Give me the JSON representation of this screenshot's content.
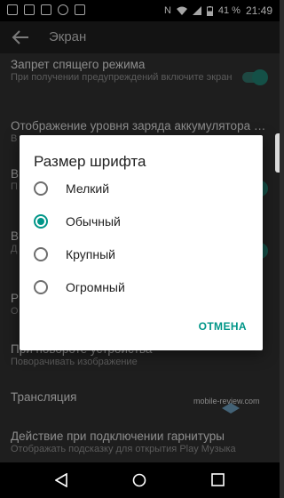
{
  "status_bar": {
    "battery": "41 %",
    "time": "21:49"
  },
  "app_bar": {
    "title": "Экран"
  },
  "settings": [
    {
      "title": "Запрет спящего режима",
      "subtitle": "При получении предупреждений включите экран",
      "toggle": true
    },
    {
      "title": "Отображение уровня заряда аккумулятора возле...",
      "subtitle": "В",
      "toggle": false
    },
    {
      "title": "В",
      "subtitle": "П",
      "toggle": true
    },
    {
      "title": "В",
      "subtitle": "Д",
      "toggle": true
    },
    {
      "title": "Р",
      "subtitle": "О",
      "toggle": false
    },
    {
      "title": "При повороте устройства",
      "subtitle": "Поворачивать изображение",
      "toggle": false
    },
    {
      "title": "Трансляция",
      "subtitle": "",
      "toggle": false
    },
    {
      "title": "Действие при подключении гарнитуры",
      "subtitle": "Отображать подсказку для открытия Play Музыка",
      "toggle": false
    }
  ],
  "dialog": {
    "title": "Размер шрифта",
    "options": [
      {
        "label": "Мелкий",
        "checked": false
      },
      {
        "label": "Обычный",
        "checked": true
      },
      {
        "label": "Крупный",
        "checked": false
      },
      {
        "label": "Огромный",
        "checked": false
      }
    ],
    "cancel_label": "ОТМЕНА"
  },
  "watermark": "mobile-review.com",
  "colors": {
    "accent": "#009688",
    "dialog_bg": "#ffffff",
    "list_bg": "#2e2e2e"
  }
}
